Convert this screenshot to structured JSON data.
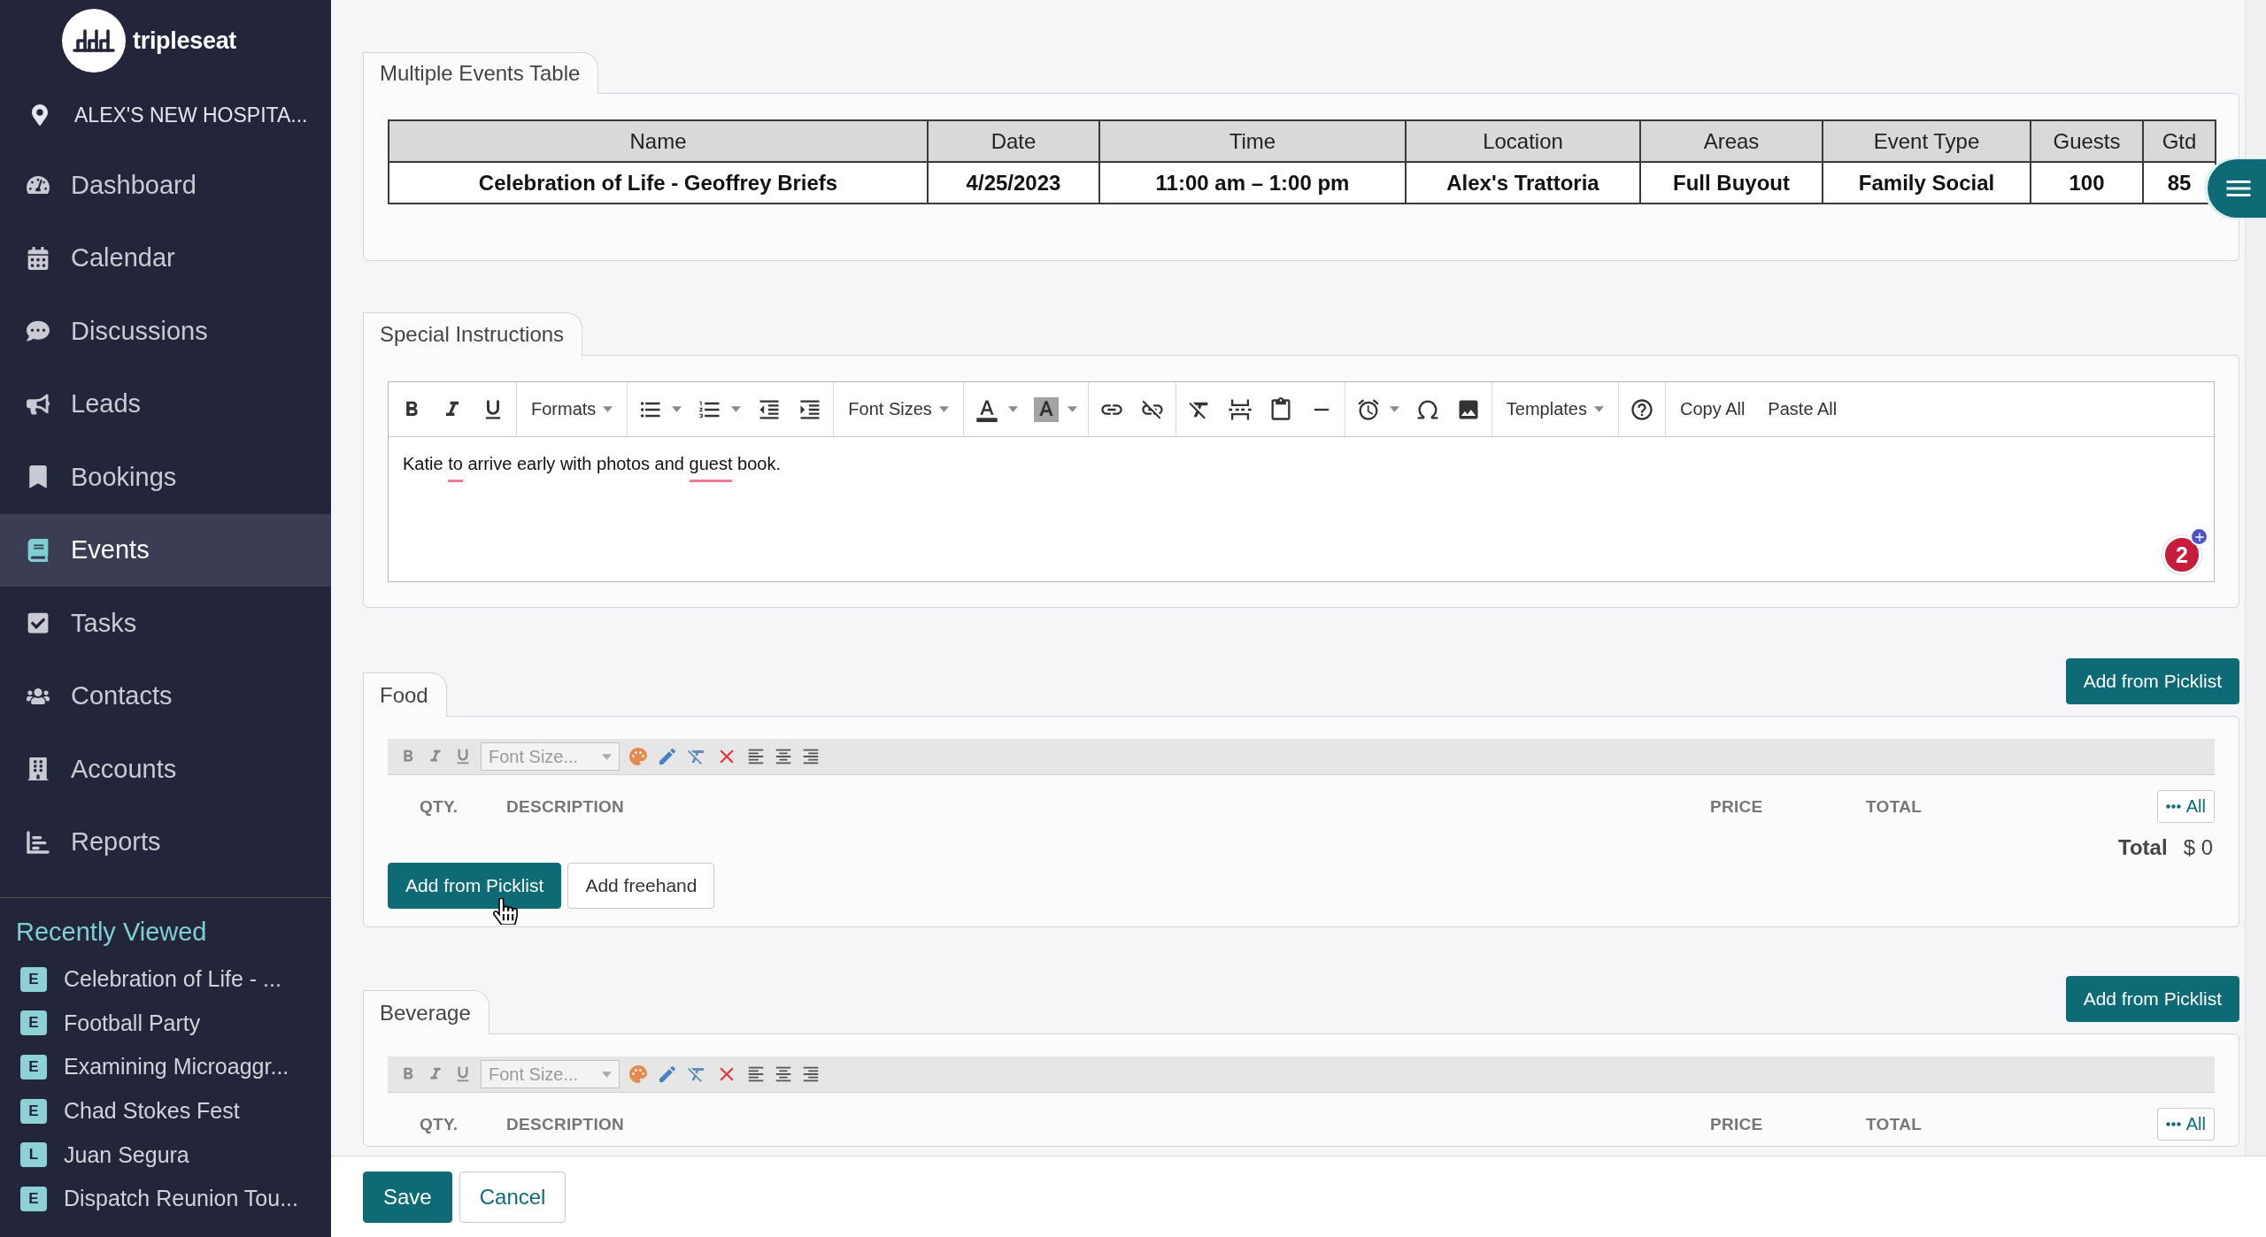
{
  "sidebar": {
    "brand": "tripleseat",
    "location": "ALEX'S NEW HOSPITA...",
    "nav": [
      {
        "label": "Dashboard",
        "selected": false
      },
      {
        "label": "Calendar",
        "selected": false
      },
      {
        "label": "Discussions",
        "selected": false
      },
      {
        "label": "Leads",
        "selected": false
      },
      {
        "label": "Bookings",
        "selected": false
      },
      {
        "label": "Events",
        "selected": true
      },
      {
        "label": "Tasks",
        "selected": false
      },
      {
        "label": "Contacts",
        "selected": false
      },
      {
        "label": "Accounts",
        "selected": false
      },
      {
        "label": "Reports",
        "selected": false
      }
    ],
    "recently_viewed": {
      "title": "Recently Viewed",
      "items": [
        {
          "badge": "E",
          "label": "Celebration of Life - ..."
        },
        {
          "badge": "E",
          "label": "Football Party"
        },
        {
          "badge": "E",
          "label": "Examining Microaggr..."
        },
        {
          "badge": "E",
          "label": "Chad Stokes Fest"
        },
        {
          "badge": "L",
          "label": "Juan Segura"
        },
        {
          "badge": "E",
          "label": "Dispatch Reunion Tou..."
        }
      ]
    }
  },
  "multiple_events": {
    "tab": "Multiple Events Table",
    "columns": [
      "Name",
      "Date",
      "Time",
      "Location",
      "Areas",
      "Event Type",
      "Guests",
      "Gtd"
    ],
    "rows": [
      [
        "Celebration of Life - Geoffrey Briefs",
        "4/25/2023",
        "11:00 am – 1:00 pm",
        "Alex's Trattoria",
        "Full Buyout",
        "Family Social",
        "100",
        "85"
      ]
    ]
  },
  "special_instructions": {
    "tab": "Special Instructions",
    "toolbar": [
      [
        {
          "kind": "icon"
        },
        {
          "kind": "icon"
        },
        {
          "kind": "icon"
        }
      ],
      [
        {
          "kind": "dropdown",
          "label": "Formats"
        }
      ],
      [
        {
          "kind": "split"
        },
        {
          "kind": "split"
        },
        {
          "kind": "icon"
        },
        {
          "kind": "icon"
        }
      ],
      [
        {
          "kind": "dropdown",
          "label": "Font Sizes"
        }
      ],
      [
        {
          "kind": "split"
        },
        {
          "kind": "split"
        }
      ],
      [
        {
          "kind": "icon"
        },
        {
          "kind": "icon"
        }
      ],
      [
        {
          "kind": "icon"
        },
        {
          "kind": "icon"
        },
        {
          "kind": "icon"
        },
        {
          "kind": "icon"
        }
      ],
      [
        {
          "kind": "split"
        },
        {
          "kind": "icon"
        },
        {
          "kind": "icon"
        }
      ],
      [
        {
          "kind": "dropdown",
          "label": "Templates"
        }
      ],
      [
        {
          "kind": "icon"
        }
      ],
      [
        {
          "kind": "text",
          "label": "Copy All"
        },
        {
          "kind": "text",
          "label": "Paste All"
        }
      ]
    ],
    "content": [
      {
        "text": "Katie ",
        "flagged": false
      },
      {
        "text": "to",
        "flagged": true
      },
      {
        "text": " arrive early with photos and ",
        "flagged": false
      },
      {
        "text": "guest",
        "flagged": true
      },
      {
        "text": " book.",
        "flagged": false
      }
    ],
    "assistant_badge": "2"
  },
  "menu_sections": [
    {
      "tab": "Food",
      "picklist_button": "Add from Picklist",
      "font_size_placeholder": "Font Size...",
      "columns": [
        "QTY.",
        "DESCRIPTION",
        "PRICE",
        "TOTAL"
      ],
      "all_button": "All",
      "total_label": "Total",
      "total_value": "$ 0",
      "actions": [
        {
          "label": "Add from Picklist",
          "kind": "primary",
          "hovered": true
        },
        {
          "label": "Add freehand",
          "kind": "secondary",
          "hovered": false
        }
      ]
    },
    {
      "tab": "Beverage",
      "picklist_button": "Add from Picklist",
      "font_size_placeholder": "Font Size...",
      "columns": [
        "QTY.",
        "DESCRIPTION",
        "PRICE",
        "TOTAL"
      ],
      "all_button": "All"
    }
  ],
  "footer": {
    "buttons": [
      {
        "label": "Save",
        "kind": "primary"
      },
      {
        "label": "Cancel",
        "kind": "secondary"
      }
    ]
  }
}
